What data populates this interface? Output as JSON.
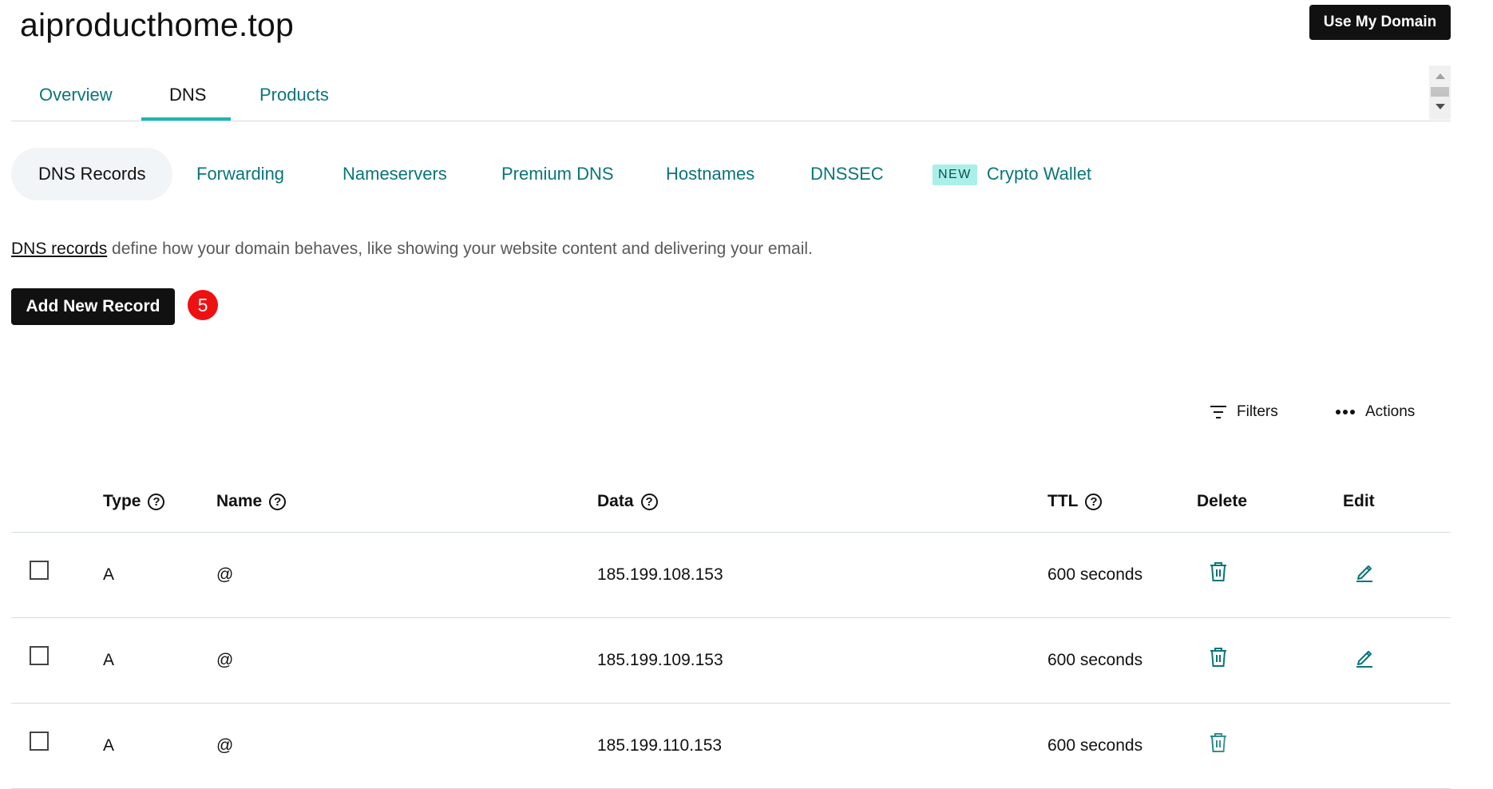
{
  "header": {
    "domain": "aiproducthome.top",
    "use_domain_button": "Use My Domain"
  },
  "main_tabs": [
    {
      "label": "Overview",
      "active": false
    },
    {
      "label": "DNS",
      "active": true
    },
    {
      "label": "Products",
      "active": false
    }
  ],
  "sub_tabs": [
    {
      "label": "DNS Records",
      "active": true
    },
    {
      "label": "Forwarding"
    },
    {
      "label": "Nameservers"
    },
    {
      "label": "Premium DNS"
    },
    {
      "label": "Hostnames"
    },
    {
      "label": "DNSSEC"
    },
    {
      "label": "Crypto Wallet",
      "badge": "NEW"
    }
  ],
  "description": {
    "link_text": "DNS records",
    "text": " define how your domain behaves, like showing your website content and delivering your email."
  },
  "add_record": {
    "label": "Add New Record",
    "count_badge": "5"
  },
  "toolbar": {
    "filters": "Filters",
    "actions": "Actions"
  },
  "table": {
    "headers": {
      "type": "Type",
      "name": "Name",
      "data": "Data",
      "ttl": "TTL",
      "delete": "Delete",
      "edit": "Edit"
    },
    "help_glyph": "?",
    "rows": [
      {
        "type": "A",
        "name": "@",
        "data": "185.199.108.153",
        "ttl": "600 seconds"
      },
      {
        "type": "A",
        "name": "@",
        "data": "185.199.109.153",
        "ttl": "600 seconds"
      },
      {
        "type": "A",
        "name": "@",
        "data": "185.199.110.153",
        "ttl": "600 seconds"
      }
    ]
  },
  "colors": {
    "accent_teal": "#09757a",
    "tab_underline": "#1bb6b6",
    "badge_red": "#ee1111",
    "new_badge_bg": "#a8f0e8"
  }
}
